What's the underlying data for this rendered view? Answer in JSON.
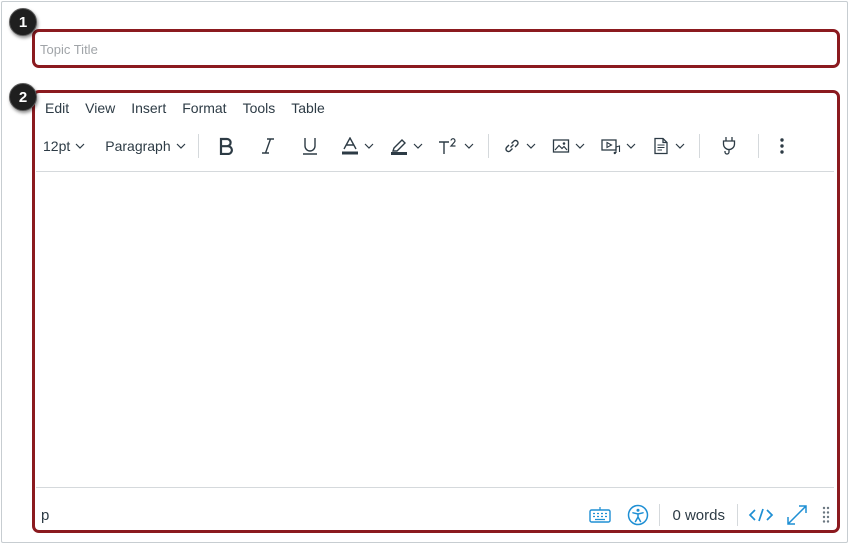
{
  "title_field": {
    "placeholder": "Topic Title",
    "value": ""
  },
  "callouts": [
    "1",
    "2"
  ],
  "menubar": [
    "Edit",
    "View",
    "Insert",
    "Format",
    "Tools",
    "Table"
  ],
  "toolbar": {
    "font_size": "12pt",
    "block_format": "Paragraph"
  },
  "statusbar": {
    "path": "p",
    "word_count": "0 words"
  },
  "colors": {
    "highlight": "#8b1a1f",
    "text": "#2d3b45",
    "accent": "#1e8fd4"
  }
}
